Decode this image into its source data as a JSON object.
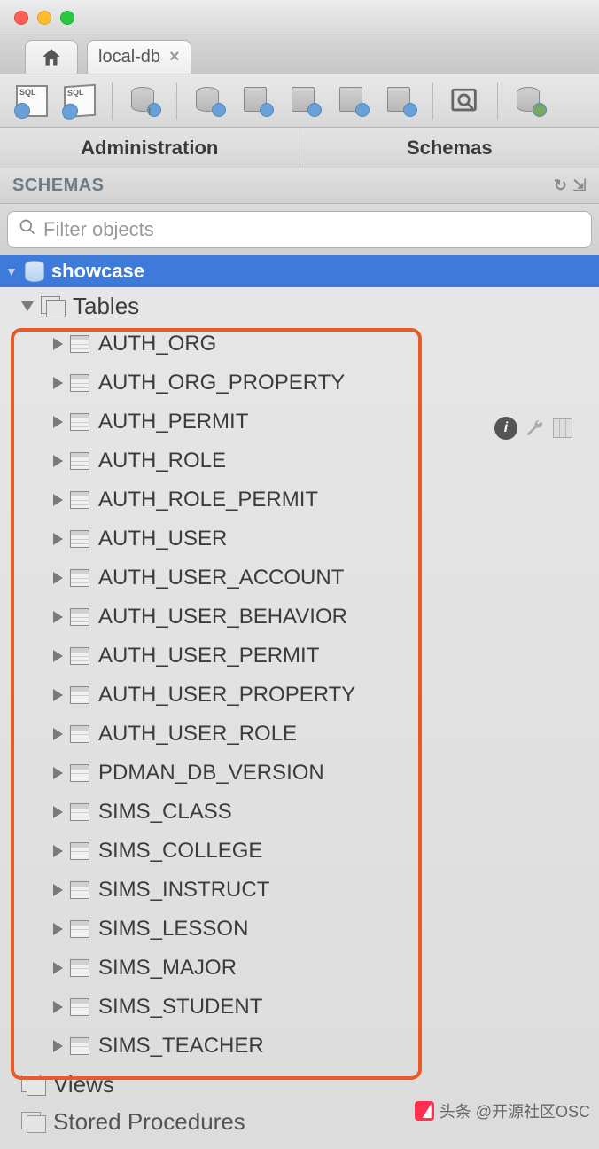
{
  "tab": {
    "label": "local-db"
  },
  "subtabs": {
    "admin": "Administration",
    "schemas": "Schemas"
  },
  "schemas_header": "SCHEMAS",
  "filter": {
    "placeholder": "Filter objects"
  },
  "schema": {
    "name": "showcase"
  },
  "tree": {
    "tables_label": "Tables",
    "views_label": "Views",
    "sp_label": "Stored Procedures",
    "tables": [
      "AUTH_ORG",
      "AUTH_ORG_PROPERTY",
      "AUTH_PERMIT",
      "AUTH_ROLE",
      "AUTH_ROLE_PERMIT",
      "AUTH_USER",
      "AUTH_USER_ACCOUNT",
      "AUTH_USER_BEHAVIOR",
      "AUTH_USER_PERMIT",
      "AUTH_USER_PROPERTY",
      "AUTH_USER_ROLE",
      "PDMAN_DB_VERSION",
      "SIMS_CLASS",
      "SIMS_COLLEGE",
      "SIMS_INSTRUCT",
      "SIMS_LESSON",
      "SIMS_MAJOR",
      "SIMS_STUDENT",
      "SIMS_TEACHER"
    ]
  },
  "watermark": "头条 @开源社区OSC"
}
